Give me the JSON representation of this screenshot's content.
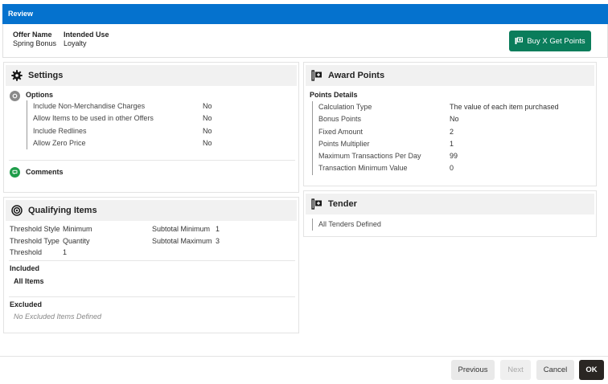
{
  "title": "Review",
  "header": {
    "offer_name_label": "Offer Name",
    "offer_name_value": "Spring Bonus",
    "intended_use_label": "Intended Use",
    "intended_use_value": "Loyalty",
    "primary_button": "Buy X Get Points"
  },
  "settings": {
    "title": "Settings",
    "options_title": "Options",
    "options": [
      {
        "label": "Include Non-Merchandise Charges",
        "value": "No"
      },
      {
        "label": "Allow Items to be used in other Offers",
        "value": "No"
      },
      {
        "label": "Include Redlines",
        "value": "No"
      },
      {
        "label": "Allow Zero Price",
        "value": "No"
      }
    ],
    "comments_title": "Comments"
  },
  "award_points": {
    "title": "Award Points",
    "details_title": "Points Details",
    "rows": [
      {
        "label": "Calculation Type",
        "value": "The value of each item purchased"
      },
      {
        "label": "Bonus Points",
        "value": "No"
      },
      {
        "label": "Fixed Amount",
        "value": "2"
      },
      {
        "label": "Points Multiplier",
        "value": "1"
      },
      {
        "label": "Maximum Transactions Per Day",
        "value": "99"
      },
      {
        "label": "Transaction Minimum Value",
        "value": "0"
      }
    ]
  },
  "qualifying": {
    "title": "Qualifying Items",
    "threshold_style_label": "Threshold Style",
    "threshold_style_value": "Minimum",
    "threshold_type_label": "Threshold Type",
    "threshold_type_value": "Quantity",
    "threshold_label": "Threshold",
    "threshold_value": "1",
    "subtotal_min_label": "Subtotal Minimum",
    "subtotal_min_value": "1",
    "subtotal_max_label": "Subtotal Maximum",
    "subtotal_max_value": "3",
    "included_title": "Included",
    "included_value": "All Items",
    "excluded_title": "Excluded",
    "excluded_value": "No Excluded Items Defined"
  },
  "tender": {
    "title": "Tender",
    "value": "All Tenders Defined"
  },
  "footer": {
    "previous": "Previous",
    "next": "Next",
    "cancel": "Cancel",
    "ok": "OK"
  },
  "colors": {
    "title_bar": "#0572ce",
    "primary_button": "#0a7d5b",
    "ok_button": "#2a2623"
  },
  "icons": {
    "settings": "gear-icon",
    "award_points": "award-points-icon",
    "qualifying": "target-icon",
    "tender": "tender-icon",
    "options": "options-icon",
    "comments": "comment-icon"
  }
}
